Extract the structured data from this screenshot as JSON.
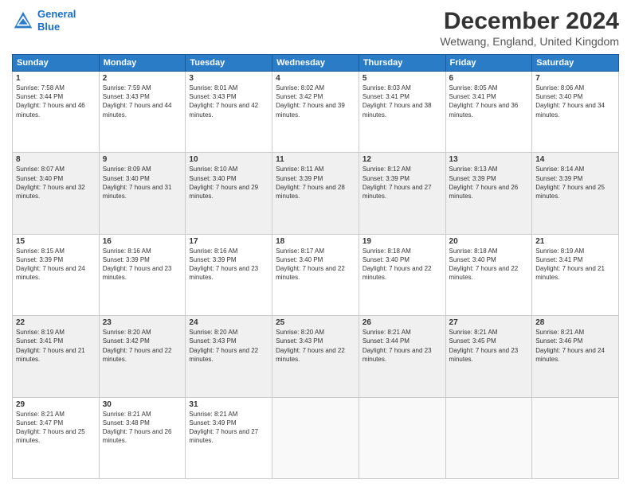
{
  "logo": {
    "line1": "General",
    "line2": "Blue"
  },
  "title": "December 2024",
  "subtitle": "Wetwang, England, United Kingdom",
  "days_of_week": [
    "Sunday",
    "Monday",
    "Tuesday",
    "Wednesday",
    "Thursday",
    "Friday",
    "Saturday"
  ],
  "weeks": [
    [
      {
        "day": "1",
        "sunrise": "Sunrise: 7:58 AM",
        "sunset": "Sunset: 3:44 PM",
        "daylight": "Daylight: 7 hours and 46 minutes."
      },
      {
        "day": "2",
        "sunrise": "Sunrise: 7:59 AM",
        "sunset": "Sunset: 3:43 PM",
        "daylight": "Daylight: 7 hours and 44 minutes."
      },
      {
        "day": "3",
        "sunrise": "Sunrise: 8:01 AM",
        "sunset": "Sunset: 3:43 PM",
        "daylight": "Daylight: 7 hours and 42 minutes."
      },
      {
        "day": "4",
        "sunrise": "Sunrise: 8:02 AM",
        "sunset": "Sunset: 3:42 PM",
        "daylight": "Daylight: 7 hours and 39 minutes."
      },
      {
        "day": "5",
        "sunrise": "Sunrise: 8:03 AM",
        "sunset": "Sunset: 3:41 PM",
        "daylight": "Daylight: 7 hours and 38 minutes."
      },
      {
        "day": "6",
        "sunrise": "Sunrise: 8:05 AM",
        "sunset": "Sunset: 3:41 PM",
        "daylight": "Daylight: 7 hours and 36 minutes."
      },
      {
        "day": "7",
        "sunrise": "Sunrise: 8:06 AM",
        "sunset": "Sunset: 3:40 PM",
        "daylight": "Daylight: 7 hours and 34 minutes."
      }
    ],
    [
      {
        "day": "8",
        "sunrise": "Sunrise: 8:07 AM",
        "sunset": "Sunset: 3:40 PM",
        "daylight": "Daylight: 7 hours and 32 minutes."
      },
      {
        "day": "9",
        "sunrise": "Sunrise: 8:09 AM",
        "sunset": "Sunset: 3:40 PM",
        "daylight": "Daylight: 7 hours and 31 minutes."
      },
      {
        "day": "10",
        "sunrise": "Sunrise: 8:10 AM",
        "sunset": "Sunset: 3:40 PM",
        "daylight": "Daylight: 7 hours and 29 minutes."
      },
      {
        "day": "11",
        "sunrise": "Sunrise: 8:11 AM",
        "sunset": "Sunset: 3:39 PM",
        "daylight": "Daylight: 7 hours and 28 minutes."
      },
      {
        "day": "12",
        "sunrise": "Sunrise: 8:12 AM",
        "sunset": "Sunset: 3:39 PM",
        "daylight": "Daylight: 7 hours and 27 minutes."
      },
      {
        "day": "13",
        "sunrise": "Sunrise: 8:13 AM",
        "sunset": "Sunset: 3:39 PM",
        "daylight": "Daylight: 7 hours and 26 minutes."
      },
      {
        "day": "14",
        "sunrise": "Sunrise: 8:14 AM",
        "sunset": "Sunset: 3:39 PM",
        "daylight": "Daylight: 7 hours and 25 minutes."
      }
    ],
    [
      {
        "day": "15",
        "sunrise": "Sunrise: 8:15 AM",
        "sunset": "Sunset: 3:39 PM",
        "daylight": "Daylight: 7 hours and 24 minutes."
      },
      {
        "day": "16",
        "sunrise": "Sunrise: 8:16 AM",
        "sunset": "Sunset: 3:39 PM",
        "daylight": "Daylight: 7 hours and 23 minutes."
      },
      {
        "day": "17",
        "sunrise": "Sunrise: 8:16 AM",
        "sunset": "Sunset: 3:39 PM",
        "daylight": "Daylight: 7 hours and 23 minutes."
      },
      {
        "day": "18",
        "sunrise": "Sunrise: 8:17 AM",
        "sunset": "Sunset: 3:40 PM",
        "daylight": "Daylight: 7 hours and 22 minutes."
      },
      {
        "day": "19",
        "sunrise": "Sunrise: 8:18 AM",
        "sunset": "Sunset: 3:40 PM",
        "daylight": "Daylight: 7 hours and 22 minutes."
      },
      {
        "day": "20",
        "sunrise": "Sunrise: 8:18 AM",
        "sunset": "Sunset: 3:40 PM",
        "daylight": "Daylight: 7 hours and 22 minutes."
      },
      {
        "day": "21",
        "sunrise": "Sunrise: 8:19 AM",
        "sunset": "Sunset: 3:41 PM",
        "daylight": "Daylight: 7 hours and 21 minutes."
      }
    ],
    [
      {
        "day": "22",
        "sunrise": "Sunrise: 8:19 AM",
        "sunset": "Sunset: 3:41 PM",
        "daylight": "Daylight: 7 hours and 21 minutes."
      },
      {
        "day": "23",
        "sunrise": "Sunrise: 8:20 AM",
        "sunset": "Sunset: 3:42 PM",
        "daylight": "Daylight: 7 hours and 22 minutes."
      },
      {
        "day": "24",
        "sunrise": "Sunrise: 8:20 AM",
        "sunset": "Sunset: 3:43 PM",
        "daylight": "Daylight: 7 hours and 22 minutes."
      },
      {
        "day": "25",
        "sunrise": "Sunrise: 8:20 AM",
        "sunset": "Sunset: 3:43 PM",
        "daylight": "Daylight: 7 hours and 22 minutes."
      },
      {
        "day": "26",
        "sunrise": "Sunrise: 8:21 AM",
        "sunset": "Sunset: 3:44 PM",
        "daylight": "Daylight: 7 hours and 23 minutes."
      },
      {
        "day": "27",
        "sunrise": "Sunrise: 8:21 AM",
        "sunset": "Sunset: 3:45 PM",
        "daylight": "Daylight: 7 hours and 23 minutes."
      },
      {
        "day": "28",
        "sunrise": "Sunrise: 8:21 AM",
        "sunset": "Sunset: 3:46 PM",
        "daylight": "Daylight: 7 hours and 24 minutes."
      }
    ],
    [
      {
        "day": "29",
        "sunrise": "Sunrise: 8:21 AM",
        "sunset": "Sunset: 3:47 PM",
        "daylight": "Daylight: 7 hours and 25 minutes."
      },
      {
        "day": "30",
        "sunrise": "Sunrise: 8:21 AM",
        "sunset": "Sunset: 3:48 PM",
        "daylight": "Daylight: 7 hours and 26 minutes."
      },
      {
        "day": "31",
        "sunrise": "Sunrise: 8:21 AM",
        "sunset": "Sunset: 3:49 PM",
        "daylight": "Daylight: 7 hours and 27 minutes."
      },
      null,
      null,
      null,
      null
    ]
  ]
}
